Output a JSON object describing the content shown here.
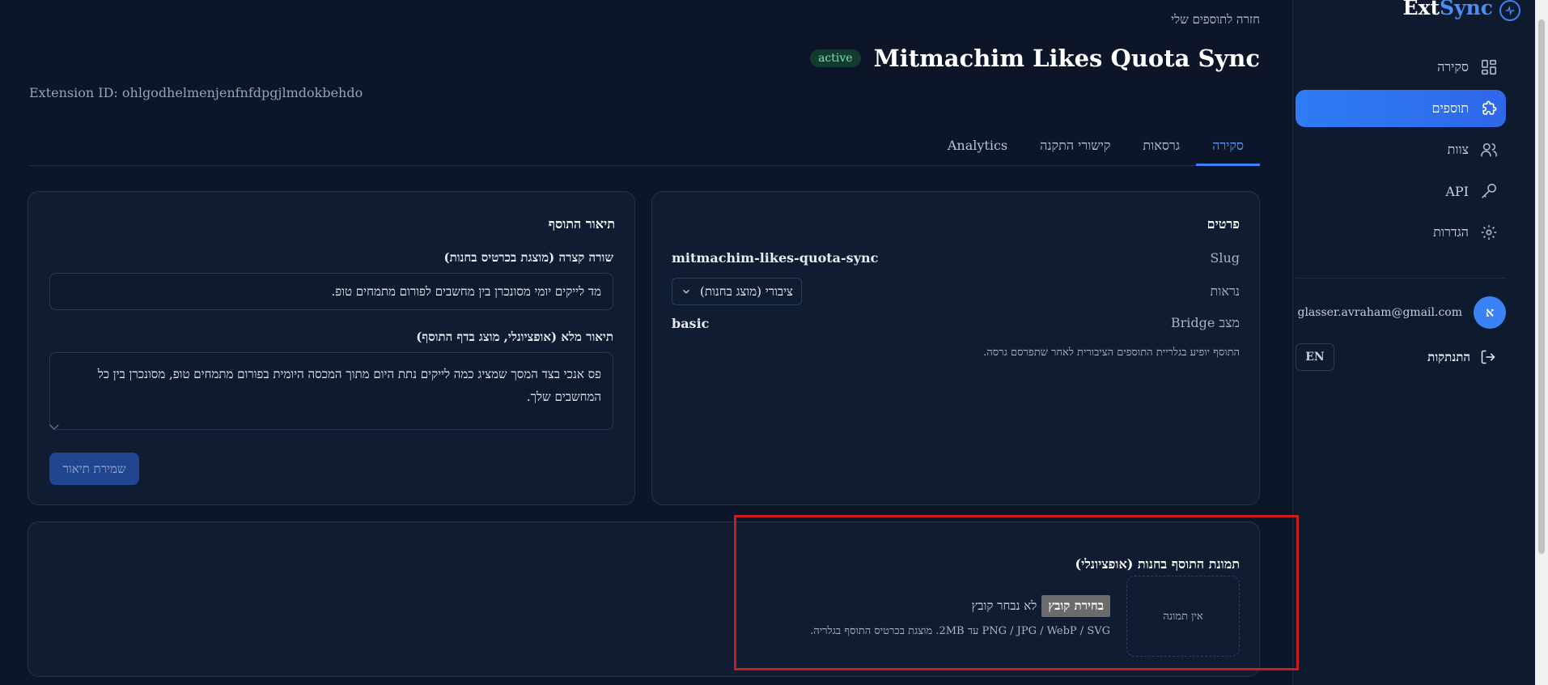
{
  "brand": {
    "ext": "Ext",
    "sync": "Sync"
  },
  "sidebar": {
    "items": [
      {
        "label": "סקירה",
        "icon": "dashboard-icon"
      },
      {
        "label": "תוספים",
        "icon": "puzzle-icon"
      },
      {
        "label": "צוות",
        "icon": "users-icon"
      },
      {
        "label": "API",
        "icon": "key-icon"
      },
      {
        "label": "הגדרות",
        "icon": "gear-icon"
      }
    ],
    "user": {
      "avatar": "א",
      "email": "glasser.avraham@gmail.com"
    },
    "logout": "התנתקות",
    "lang": "EN"
  },
  "header": {
    "back": "חזרה לתוספים שלי",
    "title": "Mitmachim Likes Quota Sync",
    "status": "active",
    "extension_id": "Extension ID: ohlgodhelmenjenfnfdpgjlmdokbehdo"
  },
  "tabs": [
    "סקירה",
    "גרסאות",
    "קישורי התקנה",
    "Analytics"
  ],
  "details": {
    "title": "פרטים",
    "slug_label": "Slug",
    "slug_value": "mitmachim-likes-quota-sync",
    "visibility_label": "נראות",
    "visibility_value": "ציבורי (מוצג בחנות)",
    "bridge_label": "מצב Bridge",
    "bridge_value": "basic",
    "note": "התוסף יופיע בגלריית התוספים הציבורית לאחר שתפרסם גרסה."
  },
  "description": {
    "title": "תיאור התוסף",
    "short_label": "שורה קצרה (מוצגת בכרטיס בחנות)",
    "short_value": "מד לייקים יומי מסונכרן בין מחשבים לפורום מתמחים טופ.",
    "full_label": "תיאור מלא (אופציונלי, מוצג בדף התוסף)",
    "full_value": "פס אנכי בצד המסך שמציג כמה לייקים נתת היום מתוך המכסה היומית בפורום מתמחים טופ, מסונכרן בין כל המחשבים שלך.",
    "save": "שמירת תיאור"
  },
  "image": {
    "title": "תמונת התוסף בחנות (אופציונלי)",
    "placeholder": "אין תמונה",
    "choose": "בחירת קובץ",
    "no_file": "לא נבחר קובץ",
    "note": "PNG / JPG / WebP / SVG עד 2MB. מוצגת בכרטיס התוסף בגלריה."
  }
}
